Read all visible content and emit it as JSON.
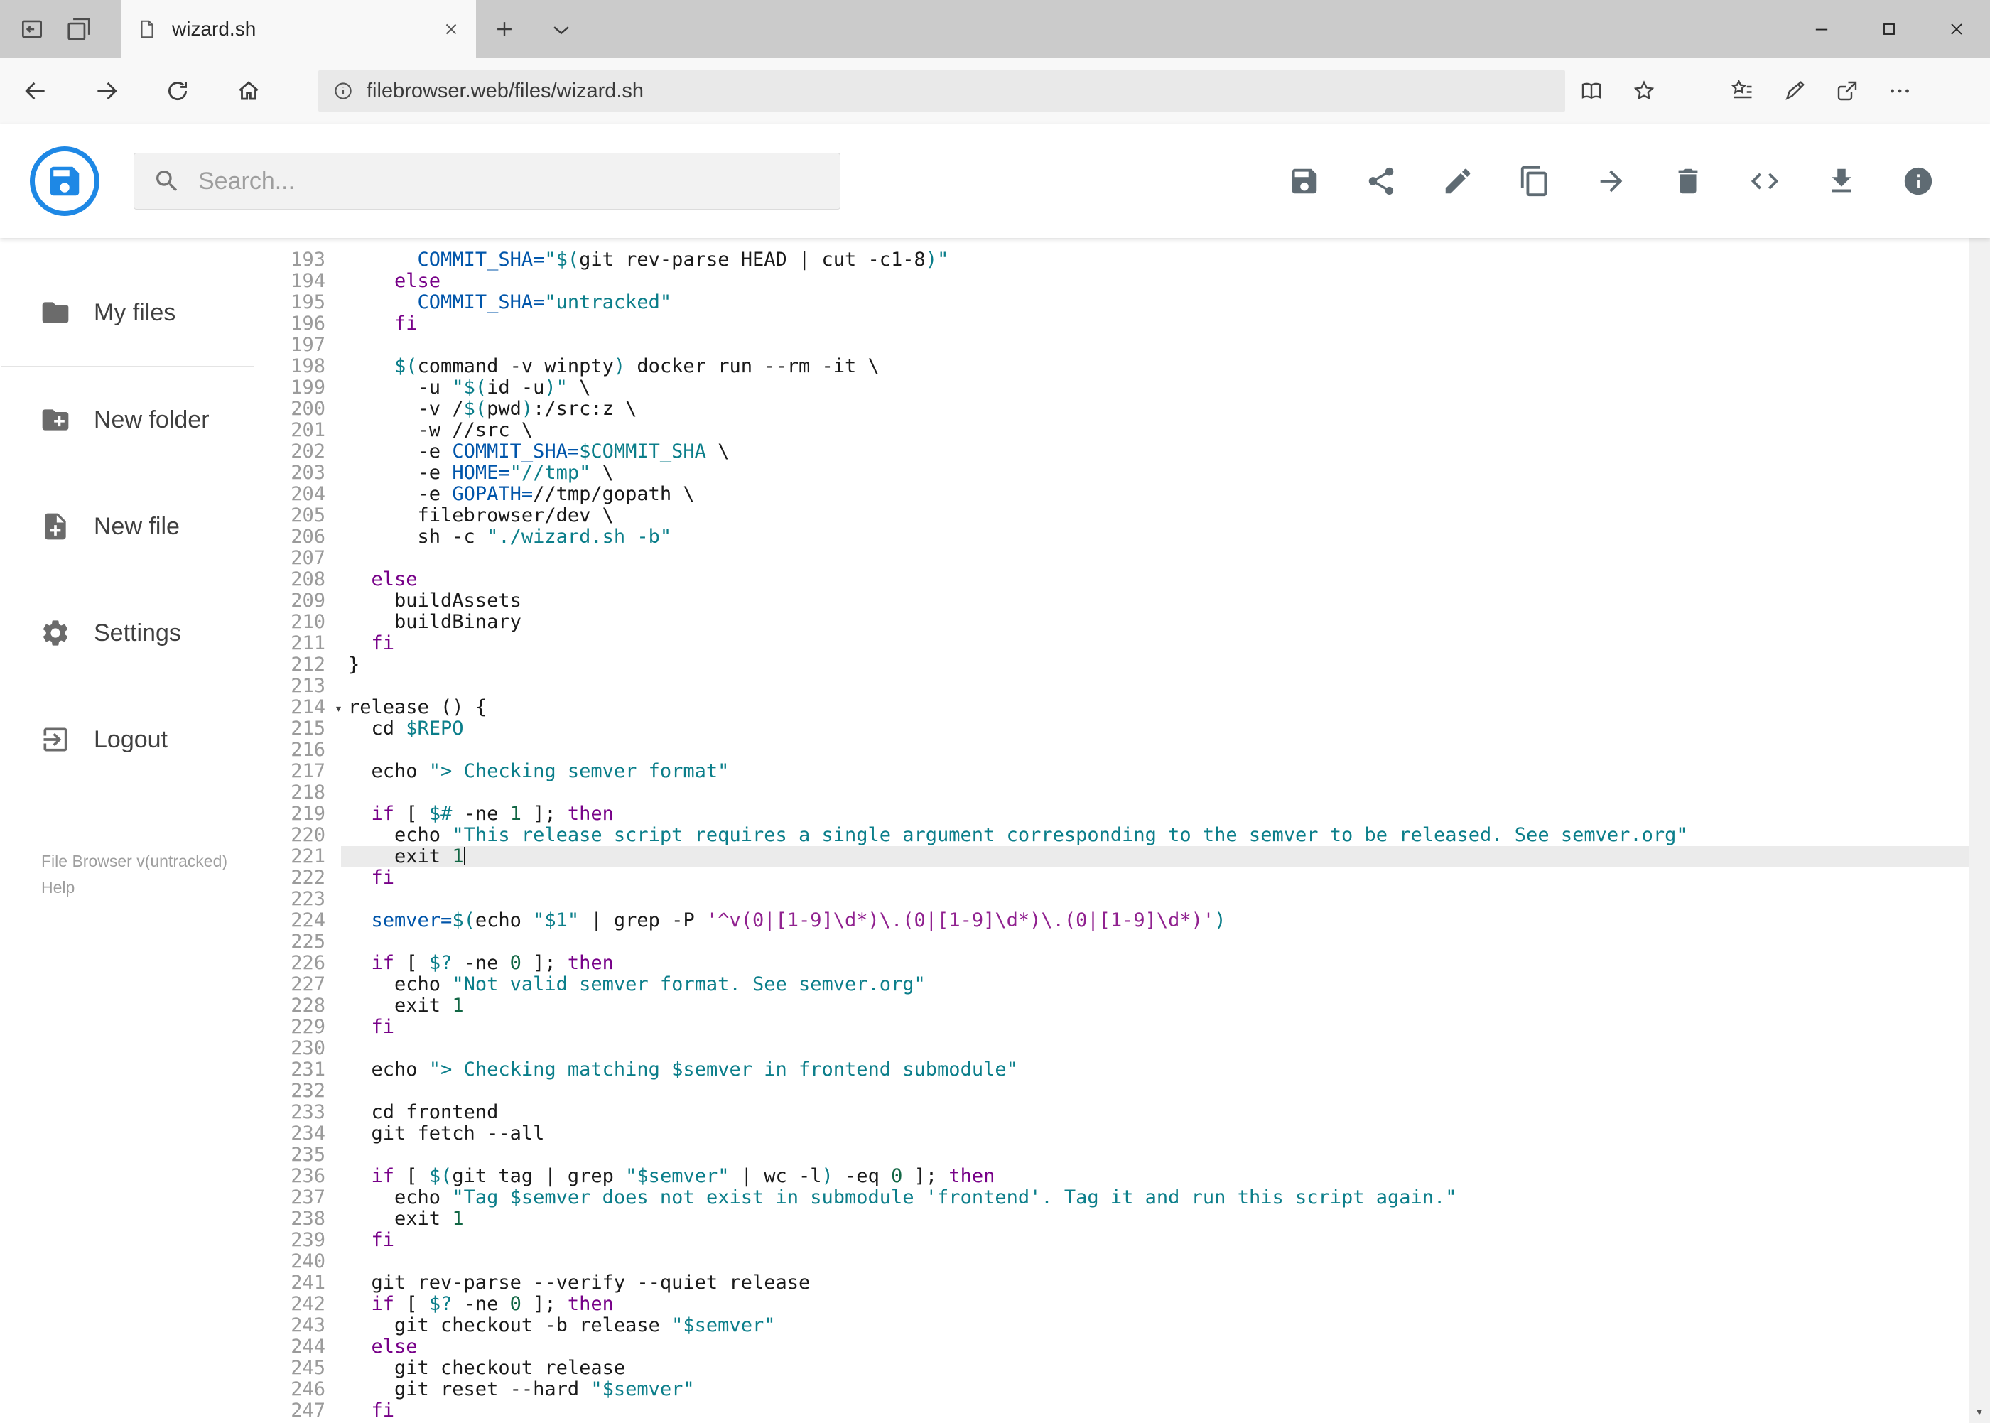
{
  "browser": {
    "tab_title": "wizard.sh",
    "url": "filebrowser.web/files/wizard.sh",
    "tabbar_icons": [
      "set-tabs-aside-icon",
      "tabs-set-aside-icon",
      "page-icon",
      "close-tab-icon",
      "new-tab-icon",
      "tab-preview-chevron-icon"
    ],
    "nav_icons": [
      "back-icon",
      "forward-icon",
      "refresh-icon",
      "home-icon"
    ],
    "urlbar_icons": [
      "site-info-icon",
      "reading-view-icon",
      "favorite-star-icon"
    ],
    "toolbar_icons": [
      "hub-icon",
      "web-note-icon",
      "share-icon",
      "more-options-icon"
    ],
    "window_controls": [
      "minimize-icon",
      "maximize-icon",
      "close-icon"
    ]
  },
  "app": {
    "search_placeholder": "Search...",
    "toolbar_icons": [
      "save-icon",
      "share-icon",
      "rename-icon",
      "copy-icon",
      "move-icon",
      "delete-icon",
      "raw-view-icon",
      "download-icon",
      "info-icon"
    ]
  },
  "sidebar": {
    "items": [
      {
        "label": "My files",
        "icon": "folder-icon"
      },
      {
        "label": "New folder",
        "icon": "new-folder-icon"
      },
      {
        "label": "New file",
        "icon": "new-file-icon"
      },
      {
        "label": "Settings",
        "icon": "gear-icon"
      },
      {
        "label": "Logout",
        "icon": "logout-icon"
      }
    ],
    "footer": {
      "version": "File Browser v(untracked)",
      "help": "Help"
    }
  },
  "colors": {
    "accent_blue": "#1e88e5",
    "keyword": "#770088",
    "string": "#0b7e8a",
    "definition": "#0055aa",
    "number": "#116644",
    "regex_string": "#90218f",
    "active_line_bg": "#ebebeb"
  },
  "editor": {
    "current_line": 221,
    "fold_line": 214,
    "lines": [
      {
        "n": 193,
        "seg": [
          [
            "p",
            "      "
          ],
          [
            "d",
            "COMMIT_SHA="
          ],
          [
            "s",
            "\"$("
          ],
          [
            "p",
            "git rev-parse HEAD | cut -c1-8"
          ],
          [
            "s",
            ")\""
          ]
        ]
      },
      {
        "n": 194,
        "seg": [
          [
            "p",
            "    "
          ],
          [
            "k",
            "else"
          ]
        ]
      },
      {
        "n": 195,
        "seg": [
          [
            "p",
            "      "
          ],
          [
            "d",
            "COMMIT_SHA="
          ],
          [
            "s",
            "\"untracked\""
          ]
        ]
      },
      {
        "n": 196,
        "seg": [
          [
            "p",
            "    "
          ],
          [
            "k",
            "fi"
          ]
        ]
      },
      {
        "n": 197,
        "seg": []
      },
      {
        "n": 198,
        "seg": [
          [
            "p",
            "    "
          ],
          [
            "s",
            "$("
          ],
          [
            "p",
            "command -v winpty"
          ],
          [
            "s",
            ")"
          ],
          [
            "p",
            " docker run --rm -it \\"
          ]
        ]
      },
      {
        "n": 199,
        "seg": [
          [
            "p",
            "      -u "
          ],
          [
            "s",
            "\"$("
          ],
          [
            "p",
            "id -u"
          ],
          [
            "s",
            ")\""
          ],
          [
            "p",
            " \\"
          ]
        ]
      },
      {
        "n": 200,
        "seg": [
          [
            "p",
            "      -v /"
          ],
          [
            "s",
            "$("
          ],
          [
            "p",
            "pwd"
          ],
          [
            "s",
            ")"
          ],
          [
            "p",
            ":/src:z \\"
          ]
        ]
      },
      {
        "n": 201,
        "seg": [
          [
            "p",
            "      -w //src \\"
          ]
        ]
      },
      {
        "n": 202,
        "seg": [
          [
            "p",
            "      -e "
          ],
          [
            "d",
            "COMMIT_SHA="
          ],
          [
            "v",
            "$COMMIT_SHA"
          ],
          [
            "p",
            " \\"
          ]
        ]
      },
      {
        "n": 203,
        "seg": [
          [
            "p",
            "      -e "
          ],
          [
            "d",
            "HOME="
          ],
          [
            "s",
            "\"//tmp\""
          ],
          [
            "p",
            " \\"
          ]
        ]
      },
      {
        "n": 204,
        "seg": [
          [
            "p",
            "      -e "
          ],
          [
            "d",
            "GOPATH="
          ],
          [
            "p",
            "//tmp/gopath \\"
          ]
        ]
      },
      {
        "n": 205,
        "seg": [
          [
            "p",
            "      filebrowser/dev \\"
          ]
        ]
      },
      {
        "n": 206,
        "seg": [
          [
            "p",
            "      sh -c "
          ],
          [
            "s",
            "\"./wizard.sh -b\""
          ]
        ]
      },
      {
        "n": 207,
        "seg": []
      },
      {
        "n": 208,
        "seg": [
          [
            "p",
            "  "
          ],
          [
            "k",
            "else"
          ]
        ]
      },
      {
        "n": 209,
        "seg": [
          [
            "p",
            "    buildAssets"
          ]
        ]
      },
      {
        "n": 210,
        "seg": [
          [
            "p",
            "    buildBinary"
          ]
        ]
      },
      {
        "n": 211,
        "seg": [
          [
            "p",
            "  "
          ],
          [
            "k",
            "fi"
          ]
        ]
      },
      {
        "n": 212,
        "seg": [
          [
            "p",
            "}"
          ]
        ]
      },
      {
        "n": 213,
        "seg": []
      },
      {
        "n": 214,
        "seg": [
          [
            "p",
            "release () {"
          ]
        ]
      },
      {
        "n": 215,
        "seg": [
          [
            "p",
            "  cd "
          ],
          [
            "v",
            "$REPO"
          ]
        ]
      },
      {
        "n": 216,
        "seg": []
      },
      {
        "n": 217,
        "seg": [
          [
            "p",
            "  echo "
          ],
          [
            "s",
            "\"> Checking semver format\""
          ]
        ]
      },
      {
        "n": 218,
        "seg": []
      },
      {
        "n": 219,
        "seg": [
          [
            "p",
            "  "
          ],
          [
            "k",
            "if"
          ],
          [
            "p",
            " [ "
          ],
          [
            "v",
            "$#"
          ],
          [
            "p",
            " -ne "
          ],
          [
            "n",
            "1"
          ],
          [
            "p",
            " ]; "
          ],
          [
            "k",
            "then"
          ]
        ]
      },
      {
        "n": 220,
        "seg": [
          [
            "p",
            "    echo "
          ],
          [
            "s",
            "\"This release script requires a single argument corresponding to the semver to be released. See semver.org\""
          ]
        ]
      },
      {
        "n": 221,
        "seg": [
          [
            "p",
            "    exit "
          ],
          [
            "n",
            "1"
          ]
        ]
      },
      {
        "n": 222,
        "seg": [
          [
            "p",
            "  "
          ],
          [
            "k",
            "fi"
          ]
        ]
      },
      {
        "n": 223,
        "seg": []
      },
      {
        "n": 224,
        "seg": [
          [
            "p",
            "  "
          ],
          [
            "d",
            "semver="
          ],
          [
            "s",
            "$("
          ],
          [
            "p",
            "echo "
          ],
          [
            "s",
            "\"$1\""
          ],
          [
            "p",
            " | grep -P "
          ],
          [
            "q",
            "'^v(0|[1-9]\\d*)\\.(0|[1-9]\\d*)\\.(0|[1-9]\\d*)'"
          ],
          [
            "s",
            ")"
          ]
        ]
      },
      {
        "n": 225,
        "seg": []
      },
      {
        "n": 226,
        "seg": [
          [
            "p",
            "  "
          ],
          [
            "k",
            "if"
          ],
          [
            "p",
            " [ "
          ],
          [
            "v",
            "$?"
          ],
          [
            "p",
            " -ne "
          ],
          [
            "n",
            "0"
          ],
          [
            "p",
            " ]; "
          ],
          [
            "k",
            "then"
          ]
        ]
      },
      {
        "n": 227,
        "seg": [
          [
            "p",
            "    echo "
          ],
          [
            "s",
            "\"Not valid semver format. See semver.org\""
          ]
        ]
      },
      {
        "n": 228,
        "seg": [
          [
            "p",
            "    exit "
          ],
          [
            "n",
            "1"
          ]
        ]
      },
      {
        "n": 229,
        "seg": [
          [
            "p",
            "  "
          ],
          [
            "k",
            "fi"
          ]
        ]
      },
      {
        "n": 230,
        "seg": []
      },
      {
        "n": 231,
        "seg": [
          [
            "p",
            "  echo "
          ],
          [
            "s",
            "\"> Checking matching "
          ],
          [
            "v",
            "$semver"
          ],
          [
            "s",
            " in frontend submodule\""
          ]
        ]
      },
      {
        "n": 232,
        "seg": []
      },
      {
        "n": 233,
        "seg": [
          [
            "p",
            "  cd frontend"
          ]
        ]
      },
      {
        "n": 234,
        "seg": [
          [
            "p",
            "  git fetch --all"
          ]
        ]
      },
      {
        "n": 235,
        "seg": []
      },
      {
        "n": 236,
        "seg": [
          [
            "p",
            "  "
          ],
          [
            "k",
            "if"
          ],
          [
            "p",
            " [ "
          ],
          [
            "s",
            "$("
          ],
          [
            "p",
            "git tag | grep "
          ],
          [
            "s",
            "\"$semver\""
          ],
          [
            "p",
            " | wc -l"
          ],
          [
            "s",
            ")"
          ],
          [
            "p",
            " -eq "
          ],
          [
            "n",
            "0"
          ],
          [
            "p",
            " ]; "
          ],
          [
            "k",
            "then"
          ]
        ]
      },
      {
        "n": 237,
        "seg": [
          [
            "p",
            "    echo "
          ],
          [
            "s",
            "\"Tag "
          ],
          [
            "v",
            "$semver"
          ],
          [
            "s",
            " does not exist in submodule 'frontend'. Tag it and run this script again.\""
          ]
        ]
      },
      {
        "n": 238,
        "seg": [
          [
            "p",
            "    exit "
          ],
          [
            "n",
            "1"
          ]
        ]
      },
      {
        "n": 239,
        "seg": [
          [
            "p",
            "  "
          ],
          [
            "k",
            "fi"
          ]
        ]
      },
      {
        "n": 240,
        "seg": []
      },
      {
        "n": 241,
        "seg": [
          [
            "p",
            "  git rev-parse --verify --quiet release"
          ]
        ]
      },
      {
        "n": 242,
        "seg": [
          [
            "p",
            "  "
          ],
          [
            "k",
            "if"
          ],
          [
            "p",
            " [ "
          ],
          [
            "v",
            "$?"
          ],
          [
            "p",
            " -ne "
          ],
          [
            "n",
            "0"
          ],
          [
            "p",
            " ]; "
          ],
          [
            "k",
            "then"
          ]
        ]
      },
      {
        "n": 243,
        "seg": [
          [
            "p",
            "    git checkout -b release "
          ],
          [
            "s",
            "\"$semver\""
          ]
        ]
      },
      {
        "n": 244,
        "seg": [
          [
            "p",
            "  "
          ],
          [
            "k",
            "else"
          ]
        ]
      },
      {
        "n": 245,
        "seg": [
          [
            "p",
            "    git checkout release"
          ]
        ]
      },
      {
        "n": 246,
        "seg": [
          [
            "p",
            "    git reset --hard "
          ],
          [
            "s",
            "\"$semver\""
          ]
        ]
      },
      {
        "n": 247,
        "seg": [
          [
            "p",
            "  "
          ],
          [
            "k",
            "fi"
          ]
        ]
      }
    ]
  }
}
